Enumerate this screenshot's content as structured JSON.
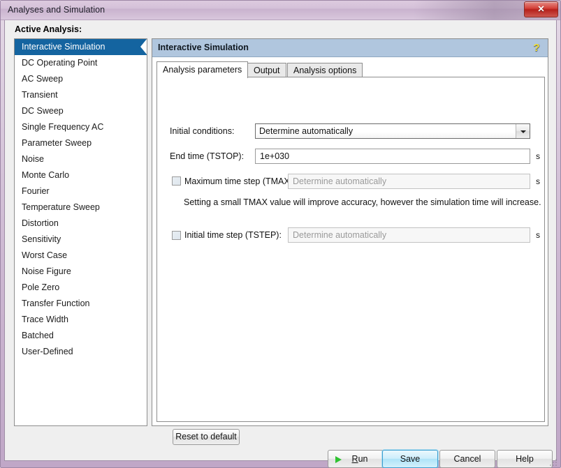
{
  "window": {
    "title": "Analyses and Simulation",
    "close_label": "✕"
  },
  "left": {
    "heading": "Active Analysis:",
    "items": [
      {
        "label": "Interactive Simulation",
        "selected": true
      },
      {
        "label": "DC Operating Point",
        "selected": false
      },
      {
        "label": "AC Sweep",
        "selected": false
      },
      {
        "label": "Transient",
        "selected": false
      },
      {
        "label": "DC Sweep",
        "selected": false
      },
      {
        "label": "Single Frequency AC",
        "selected": false
      },
      {
        "label": "Parameter Sweep",
        "selected": false
      },
      {
        "label": "Noise",
        "selected": false
      },
      {
        "label": "Monte Carlo",
        "selected": false
      },
      {
        "label": "Fourier",
        "selected": false
      },
      {
        "label": "Temperature Sweep",
        "selected": false
      },
      {
        "label": "Distortion",
        "selected": false
      },
      {
        "label": "Sensitivity",
        "selected": false
      },
      {
        "label": "Worst Case",
        "selected": false
      },
      {
        "label": "Noise Figure",
        "selected": false
      },
      {
        "label": "Pole Zero",
        "selected": false
      },
      {
        "label": "Transfer Function",
        "selected": false
      },
      {
        "label": "Trace Width",
        "selected": false
      },
      {
        "label": "Batched",
        "selected": false
      },
      {
        "label": "User-Defined",
        "selected": false
      }
    ]
  },
  "panel": {
    "header_title": "Interactive Simulation",
    "help_icon": "?",
    "tabs": [
      {
        "label": "Analysis parameters",
        "active": true
      },
      {
        "label": "Output",
        "active": false
      },
      {
        "label": "Analysis options",
        "active": false
      }
    ]
  },
  "form": {
    "initial_conditions": {
      "label": "Initial conditions:",
      "value": "Determine automatically"
    },
    "end_time": {
      "label": "End time (TSTOP):",
      "value": "1e+030",
      "unit": "s"
    },
    "max_time_step": {
      "label": "Maximum time step (TMAX):",
      "checked": false,
      "placeholder": "Determine automatically",
      "unit": "s"
    },
    "hint": "Setting a small TMAX value will improve accuracy, however the simulation time will increase.",
    "initial_time_step": {
      "label": "Initial time step (TSTEP):",
      "checked": false,
      "placeholder": "Determine automatically",
      "unit": "s"
    },
    "reset_label": "Reset to default"
  },
  "footer": {
    "run_prefix": "R",
    "run_suffix": "un",
    "save_label": "Save",
    "cancel_label": "Cancel",
    "help_label": "Help"
  }
}
